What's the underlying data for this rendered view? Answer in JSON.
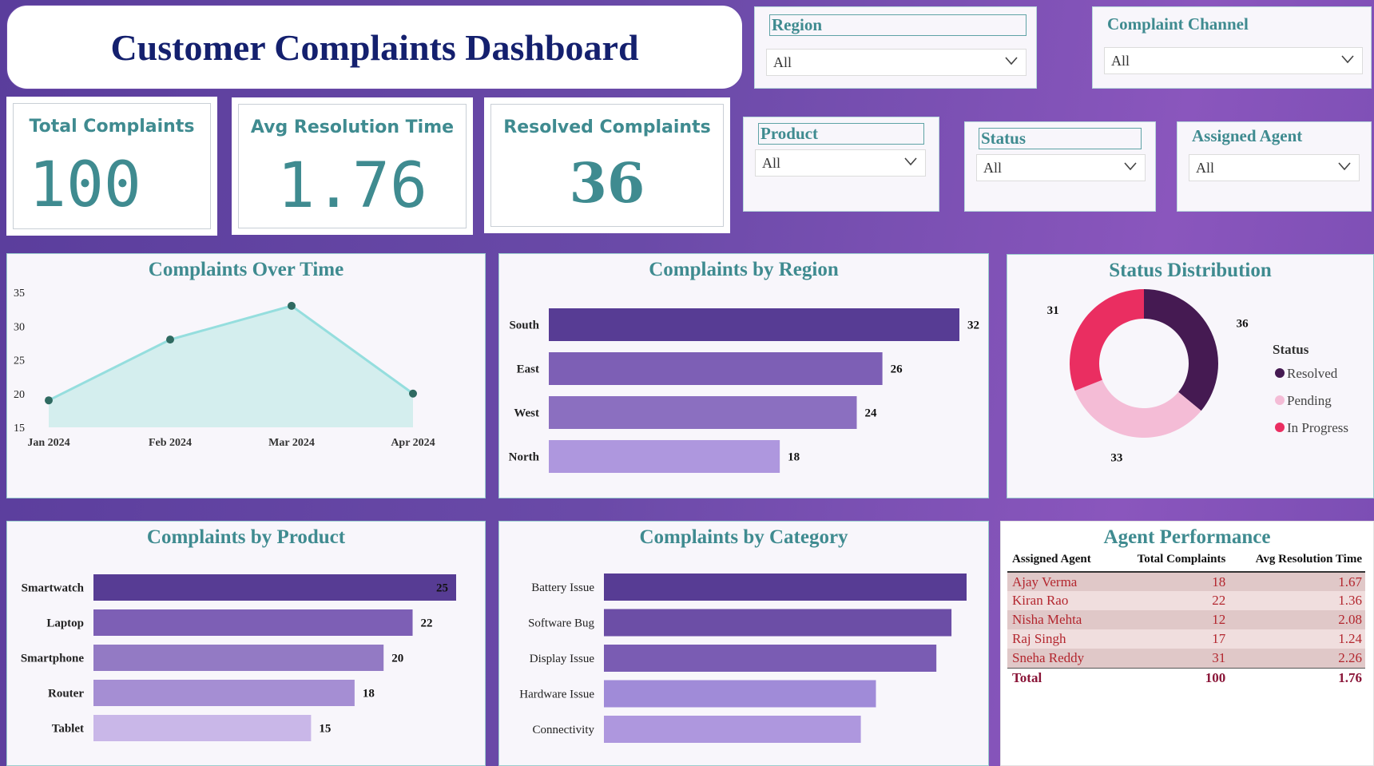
{
  "title": "Customer Complaints Dashboard",
  "slicers": [
    {
      "label": "Region",
      "value": "All"
    },
    {
      "label": "Complaint Channel",
      "value": "All"
    },
    {
      "label": "Product",
      "value": "All"
    },
    {
      "label": "Status",
      "value": "All"
    },
    {
      "label": "Assigned Agent",
      "value": "All"
    }
  ],
  "kpis": {
    "total": {
      "label": "Total Complaints",
      "value": "100"
    },
    "avg": {
      "label": "Avg Resolution Time",
      "value": "1.76"
    },
    "resolved": {
      "label": "Resolved Complaints",
      "value": "36"
    }
  },
  "charts": {
    "over_time_title": "Complaints Over Time",
    "region_title": "Complaints by Region",
    "status_title": "Status Distribution",
    "product_title": "Complaints by Product",
    "category_title": "Complaints by Category",
    "agent_title": "Agent Performance"
  },
  "colors": {
    "accent": "#3f8b90",
    "title": "#14206e",
    "bar_dark": "#573c94",
    "resolved": "#451a52",
    "pending": "#f4bcd6",
    "in_progress": "#ea2e61"
  },
  "chart_data": [
    {
      "type": "area",
      "title": "Complaints Over Time",
      "categories": [
        "Jan 2024",
        "Feb 2024",
        "Mar 2024",
        "Apr 2024"
      ],
      "values": [
        19,
        28,
        33,
        20
      ],
      "ylim": [
        15,
        35
      ],
      "yticks": [
        "15",
        "20",
        "25",
        "30",
        "35"
      ]
    },
    {
      "type": "bar",
      "orientation": "horizontal",
      "title": "Complaints by Region",
      "categories": [
        "South",
        "East",
        "West",
        "North"
      ],
      "values": [
        32,
        26,
        24,
        18
      ],
      "colors": [
        "#573c94",
        "#7d5fb5",
        "#8b6fc0",
        "#ae97de"
      ]
    },
    {
      "type": "pie",
      "title": "Status Distribution",
      "legend_title": "Status",
      "legend_position": "right",
      "labels": [
        "Resolved",
        "Pending",
        "In Progress"
      ],
      "values": [
        36,
        33,
        31
      ],
      "colors": [
        "#451a52",
        "#f4bcd6",
        "#ea2e61"
      ]
    },
    {
      "type": "bar",
      "orientation": "horizontal",
      "title": "Complaints by Product",
      "categories": [
        "Smartwatch",
        "Laptop",
        "Smartphone",
        "Router",
        "Tablet"
      ],
      "values": [
        25,
        22,
        20,
        18,
        15
      ],
      "colors": [
        "#573c94",
        "#7d5fb5",
        "#937ac4",
        "#a58ed3",
        "#c9b7e8"
      ]
    },
    {
      "type": "bar",
      "orientation": "horizontal",
      "title": "Complaints by Category",
      "categories": [
        "Battery Issue",
        "Software Bug",
        "Display Issue",
        "Hardware Issue",
        "Connectivity"
      ],
      "values": [
        24,
        23,
        22,
        18,
        17
      ],
      "xlim": [
        0,
        24
      ],
      "colors": [
        "#573c94",
        "#6c4ea6",
        "#7a5cb3",
        "#a08bd8",
        "#ae97de"
      ]
    },
    {
      "type": "table",
      "title": "Agent Performance",
      "columns": [
        "Assigned Agent",
        "Total Complaints",
        "Avg Resolution Time"
      ],
      "rows": [
        [
          "Ajay Verma",
          "18",
          "1.67"
        ],
        [
          "Kiran Rao",
          "22",
          "1.36"
        ],
        [
          "Nisha Mehta",
          "12",
          "2.08"
        ],
        [
          "Raj Singh",
          "17",
          "1.24"
        ],
        [
          "Sneha Reddy",
          "31",
          "2.26"
        ]
      ],
      "total": [
        "Total",
        "100",
        "1.76"
      ]
    }
  ]
}
